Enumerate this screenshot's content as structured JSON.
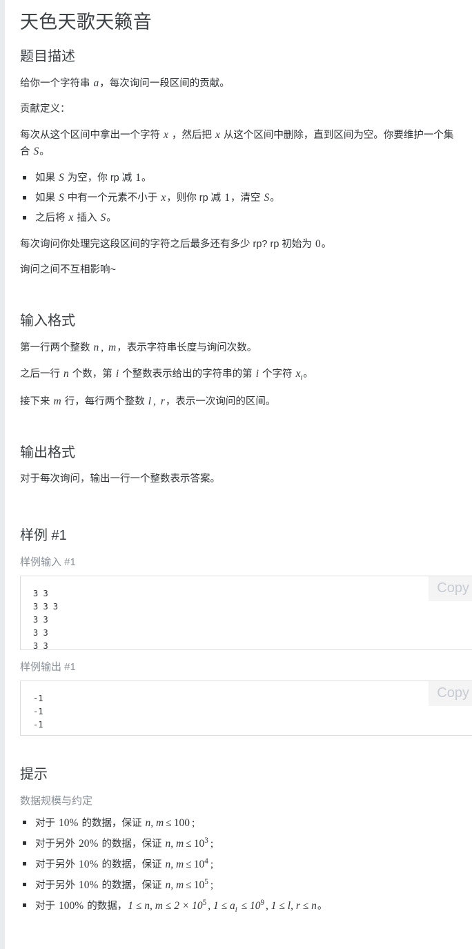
{
  "problem": {
    "title": "天色天歌天籁音"
  },
  "sections": {
    "description_heading": "题目描述",
    "input_heading": "输入格式",
    "output_heading": "输出格式",
    "sample_heading": "样例 #1",
    "hint_heading": "提示"
  },
  "description": {
    "p1_pre": "给你一个字符串 ",
    "p1_var": "a",
    "p1_post": "，每次询问一段区间的贡献。",
    "p2": "贡献定义：",
    "p3_a": "每次从这个区间中拿出一个字符 ",
    "p3_x1": "x",
    "p3_b": " ，然后把 ",
    "p3_x2": "x",
    "p3_c": " 从这个区间中删除，直到区间为空。你要维护一个集合 ",
    "p3_S": "S",
    "p3_d": "。",
    "bullets": [
      {
        "a": "如果 ",
        "v1": "S",
        "b": " 为空，你 rp 减 ",
        "n1": "1",
        "c": "。"
      },
      {
        "a": "如果 ",
        "v1": "S",
        "b": " 中有一个元素不小于 ",
        "v2": "x",
        "c": "，则你 rp 减 ",
        "n1": "1",
        "d": "，清空 ",
        "v3": "S",
        "e": "。"
      },
      {
        "a": "之后将 ",
        "v1": "x",
        "b": " 插入 ",
        "v2": "S",
        "c": "。"
      }
    ],
    "p4_a": "每次询问你处理完这段区间的字符之后最多还有多少 rp? rp 初始为 ",
    "p4_n": "0",
    "p4_b": "。",
    "p5": "询问之间不互相影响~"
  },
  "input_format": {
    "l1_a": "第一行两个整数 ",
    "l1_n": "n",
    "l1_b": ", ",
    "l1_m": "m",
    "l1_c": "，表示字符串长度与询问次数。",
    "l2_a": "之后一行 ",
    "l2_n": "n",
    "l2_b": " 个数，第 ",
    "l2_i1": "i",
    "l2_c": " 个整数表示给出的字符串的第 ",
    "l2_i2": "i",
    "l2_d": " 个字符 ",
    "l2_xi": "x",
    "l2_xi_sub": "i",
    "l2_e": "。",
    "l3_a": "接下来 ",
    "l3_m": "m",
    "l3_b": " 行，每行两个整数 ",
    "l3_l": "l",
    "l3_c": ", ",
    "l3_r": "r",
    "l3_d": "，表示一次询问的区间。"
  },
  "output_format": {
    "line": "对于每次询问，输出一行一个整数表示答案。"
  },
  "sample": {
    "input_label": "样例输入 #1",
    "output_label": "样例输出 #1",
    "copy_label": "Copy",
    "input_text": "3 3\n3 3 3\n3 3\n3 3\n3 3",
    "output_text": "-1\n-1\n-1"
  },
  "hint": {
    "subtitle": "数据规模与约定",
    "items": [
      {
        "a": "对于 ",
        "pct": "10%",
        "b": " 的数据，保证 ",
        "vars": "n, m",
        "le": "≤",
        "val": "100",
        "val_sup": "",
        "end": ";"
      },
      {
        "a": "对于另外 ",
        "pct": "20%",
        "b": " 的数据，保证 ",
        "vars": "n, m",
        "le": "≤",
        "val": "10",
        "val_sup": "3",
        "end": ";"
      },
      {
        "a": "对于另外 ",
        "pct": "10%",
        "b": " 的数据，保证 ",
        "vars": "n, m",
        "le": "≤",
        "val": "10",
        "val_sup": "4",
        "end": ";"
      },
      {
        "a": "对于另外 ",
        "pct": "10%",
        "b": " 的数据，保证 ",
        "vars": "n, m",
        "le": "≤",
        "val": "10",
        "val_sup": "5",
        "end": ";"
      }
    ],
    "last": {
      "a": "对于 ",
      "pct": "100%",
      "b": " 的数据，",
      "c1": "1 ≤ n, m ≤ 2 × 10",
      "c1_sup": "5",
      "c2": ", 1 ≤ a",
      "c2_sub": "i",
      "c3": " ≤ 10",
      "c3_sup": "9",
      "c4": ", 1 ≤ l, r ≤ n",
      "end": "。"
    }
  },
  "colors": {
    "page_bg": "#e9ecef",
    "card_bg": "#ffffff",
    "text": "#2f3337",
    "muted": "#8a9199",
    "border": "#dcdcdc",
    "copy_bg": "#f4f4f4"
  }
}
